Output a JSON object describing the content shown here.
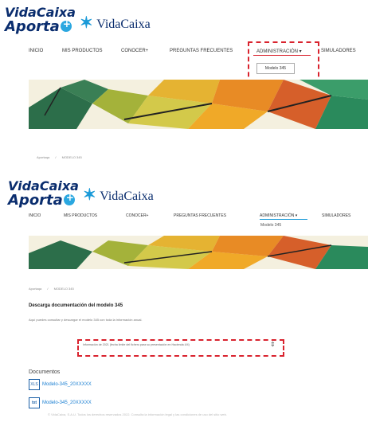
{
  "top": {
    "logo": {
      "line1": "VidaCaixa",
      "line2": "Aporta"
    },
    "brand": "VidaCaixa",
    "nav": [
      "INICIO",
      "MIS PRODUCTOS",
      "CONOCER+",
      "PREGUNTAS FRECUENTES",
      "ADMINISTRACIÓN ▾",
      "SIMULADORES"
    ],
    "dropdown_item": "Modelo 345",
    "breadcrumb": [
      "Aportaqa",
      "MODELO 345"
    ]
  },
  "bottom": {
    "logo": {
      "line1": "VidaCaixa",
      "line2": "Aporta"
    },
    "brand": "VidaCaixa",
    "nav": [
      "INICIO",
      "MIS PRODUCTOS",
      "CONOCER+",
      "PREGUNTAS FRECUENTES",
      "ADMINISTRACIÓN ▾",
      "SIMULADORES"
    ],
    "sub_item": "Modelo 345",
    "breadcrumb": [
      "Aportaqa",
      "MODELO 345"
    ],
    "heading": "Descarga documentación del modelo 345",
    "intro": "Aquí puedes consultar y descargar el modelo 345 con toda la información anual.",
    "select_value": "Información de 2021 (fecha límite del fichero para su presentación en Hacienda 4/4)",
    "documents_title": "Documentos",
    "documents": [
      {
        "icon": "XLS",
        "label": "Modelo-345_20XXXXX"
      },
      {
        "icon": "txt",
        "label": "Modelo-345_20XXXXX"
      }
    ],
    "footer": "© VidaCaixa, S.A.U. Todos los derechos reservados 2022. Consulta la información legal y las condiciones de uso del sitio web."
  },
  "colors": {
    "brand_dark": "#0a2d6e",
    "accent": "#1a9ad8",
    "highlight": "#d9232e"
  }
}
